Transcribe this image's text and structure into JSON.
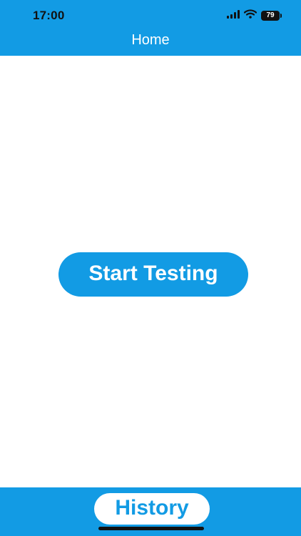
{
  "status_bar": {
    "time": "17:00",
    "battery_level": "79",
    "icons": [
      "cellular-signal-icon",
      "wifi-icon",
      "battery-icon"
    ]
  },
  "header": {
    "title": "Home"
  },
  "main": {
    "start_button_label": "Start Testing"
  },
  "footer": {
    "history_button_label": "History"
  },
  "colors": {
    "brand_blue": "#129be4",
    "background": "#ffffff",
    "status_text": "#111111"
  }
}
